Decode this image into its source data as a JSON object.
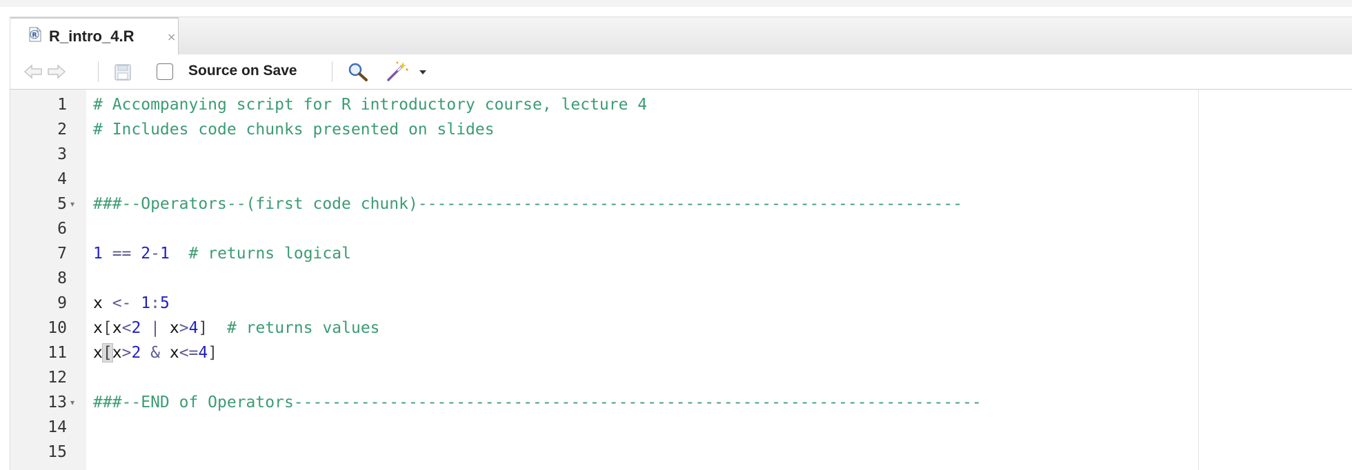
{
  "tab": {
    "filename": "R_intro_4.R",
    "close_glyph": "×",
    "file_icon": "r-file-icon"
  },
  "toolbar": {
    "back_icon": "arrow-left-icon",
    "forward_icon": "arrow-right-icon",
    "save_icon": "save-disk-icon",
    "source_on_save_label": "Source on Save",
    "source_on_save_checked": false,
    "search_icon": "magnifier-icon",
    "code_tools_icon": "magic-wand-icon",
    "code_tools_dropdown_icon": "chevron-down-icon"
  },
  "editor": {
    "lines": [
      {
        "num": "1",
        "fold": false,
        "tokens": [
          {
            "t": "comment",
            "v": "# Accompanying script for R introductory course, lecture 4"
          }
        ]
      },
      {
        "num": "2",
        "fold": false,
        "tokens": [
          {
            "t": "comment",
            "v": "# Includes code chunks presented on slides"
          }
        ]
      },
      {
        "num": "3",
        "fold": false,
        "tokens": []
      },
      {
        "num": "4",
        "fold": false,
        "tokens": []
      },
      {
        "num": "5",
        "fold": true,
        "tokens": [
          {
            "t": "comment",
            "v": "###--Operators--(first code chunk)---------------------------------------------------------"
          }
        ]
      },
      {
        "num": "6",
        "fold": false,
        "tokens": []
      },
      {
        "num": "7",
        "fold": false,
        "tokens": [
          {
            "t": "number",
            "v": "1"
          },
          {
            "t": "op",
            "v": " == "
          },
          {
            "t": "number",
            "v": "2"
          },
          {
            "t": "op",
            "v": "-"
          },
          {
            "t": "number",
            "v": "1"
          },
          {
            "t": "comment",
            "v": "  # returns logical"
          }
        ]
      },
      {
        "num": "8",
        "fold": false,
        "tokens": []
      },
      {
        "num": "9",
        "fold": false,
        "tokens": [
          {
            "t": "ident",
            "v": "x"
          },
          {
            "t": "op",
            "v": " <- "
          },
          {
            "t": "number",
            "v": "1"
          },
          {
            "t": "op",
            "v": ":"
          },
          {
            "t": "number",
            "v": "5"
          }
        ]
      },
      {
        "num": "10",
        "fold": false,
        "tokens": [
          {
            "t": "ident",
            "v": "x"
          },
          {
            "t": "bracket",
            "v": "["
          },
          {
            "t": "ident",
            "v": "x"
          },
          {
            "t": "op",
            "v": "<"
          },
          {
            "t": "number",
            "v": "2"
          },
          {
            "t": "op",
            "v": " | "
          },
          {
            "t": "ident",
            "v": "x"
          },
          {
            "t": "op",
            "v": ">"
          },
          {
            "t": "number",
            "v": "4"
          },
          {
            "t": "bracket",
            "v": "]"
          },
          {
            "t": "comment",
            "v": "  # returns values"
          }
        ]
      },
      {
        "num": "11",
        "fold": false,
        "tokens": [
          {
            "t": "ident",
            "v": "x"
          },
          {
            "t": "cursor",
            "v": "["
          },
          {
            "t": "ident",
            "v": "x"
          },
          {
            "t": "op",
            "v": ">"
          },
          {
            "t": "number",
            "v": "2"
          },
          {
            "t": "op",
            "v": " & "
          },
          {
            "t": "ident",
            "v": "x"
          },
          {
            "t": "op",
            "v": "<="
          },
          {
            "t": "number",
            "v": "4"
          },
          {
            "t": "bracket",
            "v": "]"
          }
        ]
      },
      {
        "num": "12",
        "fold": false,
        "tokens": []
      },
      {
        "num": "13",
        "fold": true,
        "tokens": [
          {
            "t": "comment",
            "v": "###--END of Operators------------------------------------------------------------------------"
          }
        ]
      },
      {
        "num": "14",
        "fold": false,
        "tokens": []
      },
      {
        "num": "15",
        "fold": false,
        "tokens": []
      }
    ],
    "fold_glyph": "▾"
  },
  "colors": {
    "comment": "#3c9c73",
    "number": "#1e1ec8",
    "identifier": "#111111"
  }
}
